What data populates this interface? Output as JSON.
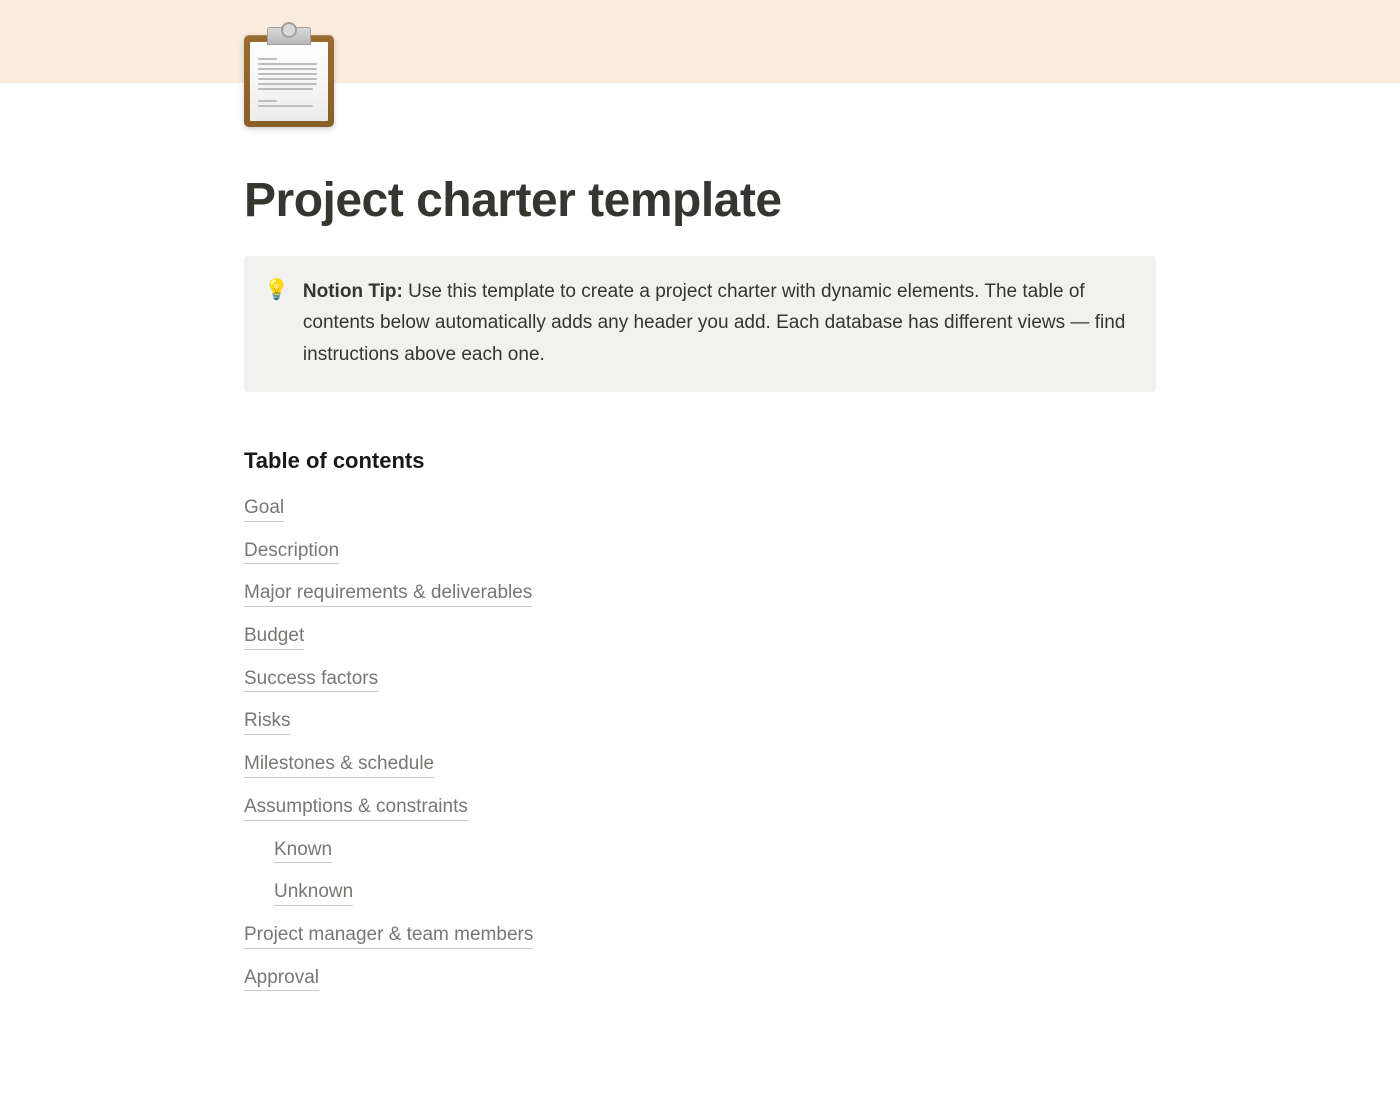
{
  "page": {
    "title": "Project charter template",
    "icon_name": "clipboard"
  },
  "callout": {
    "icon": "💡",
    "label": "Notion Tip:",
    "body": " Use this template to create a project charter with dynamic elements. The table of contents below automatically adds any header you add. Each database has different views — find instructions above each one."
  },
  "toc": {
    "heading": "Table of contents",
    "items": [
      {
        "label": "Goal",
        "children": []
      },
      {
        "label": "Description",
        "children": []
      },
      {
        "label": "Major requirements & deliverables",
        "children": []
      },
      {
        "label": "Budget",
        "children": []
      },
      {
        "label": "Success factors",
        "children": []
      },
      {
        "label": "Risks",
        "children": []
      },
      {
        "label": "Milestones & schedule",
        "children": []
      },
      {
        "label": "Assumptions & constraints",
        "children": [
          {
            "label": "Known"
          },
          {
            "label": "Unknown"
          }
        ]
      },
      {
        "label": "Project manager & team members",
        "children": []
      },
      {
        "label": "Approval",
        "children": []
      }
    ]
  }
}
